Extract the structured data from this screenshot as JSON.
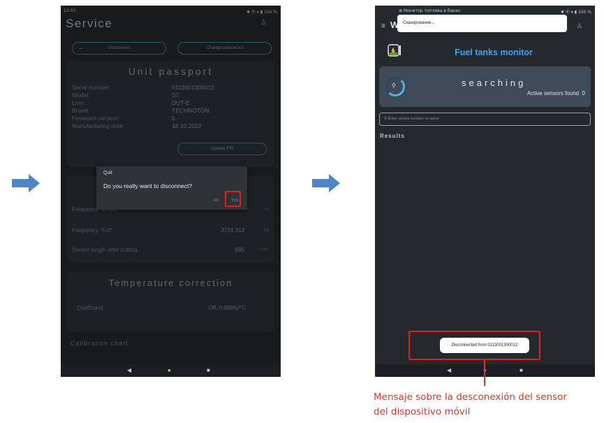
{
  "arrows": [
    {
      "name": "arrow-1"
    },
    {
      "name": "arrow-2"
    }
  ],
  "left_screen": {
    "status_time": "13:03",
    "status_right": "✱ ⦿ ▾ ▮ 100 %",
    "title": "Service",
    "buttons": {
      "disconnect": "Disconnect",
      "change_password": "Change password"
    },
    "passport": {
      "title": "Unit passport",
      "labels": [
        "Serial number:",
        "Model:",
        "Line:",
        "Brand:",
        "Firmware version:",
        "Manufacturing date:"
      ],
      "values": [
        "0113001300012",
        "S7",
        "DUT-E",
        "TECHNOTON",
        "5",
        "18.10.2022"
      ],
      "update_fw": "Update FW"
    },
    "calibration_rows": [
      {
        "label": "Frequency \"Empty\"",
        "value": "",
        "unit": "Hz"
      },
      {
        "label": "Frequency \"Full\"",
        "value": "3724.313",
        "unit": "Hz"
      },
      {
        "label": "Sensor length after cutting",
        "value": "695",
        "unit": "mm"
      }
    ],
    "temperature": {
      "title": "Temperature correction",
      "label": "Coefficient",
      "value": "Off, 0.000%/°C"
    },
    "calibration_chart": "Calibration chart",
    "dialog": {
      "title": "Quit",
      "message": "Do you really want to disconnect?",
      "no": "NO",
      "yes": "YES"
    }
  },
  "right_screen": {
    "status_left": "⊕ Монитор топлива в баках",
    "status_right": "✱ ⦿ ▾ ▮ 100 %",
    "toast_top": "Сканирование...",
    "header_letter": "W",
    "title": "Fuel tanks monitor",
    "scan": {
      "status": "searching",
      "found_label": "Active sensors found",
      "found_count": "0"
    },
    "search_placeholder": "Enter sensor number or name",
    "results_label": "Results",
    "snackbar": "Disconnected from 0113001300012"
  },
  "caption": [
    "Mensaje sobre la desconexión del sensor",
    "del dispositivo móvil"
  ],
  "colors": {
    "accent_blue": "#3fa4e8",
    "highlight_red": "#e0201f",
    "caption_red": "#d03a2c",
    "arrow_blue": "#4a86c8"
  }
}
